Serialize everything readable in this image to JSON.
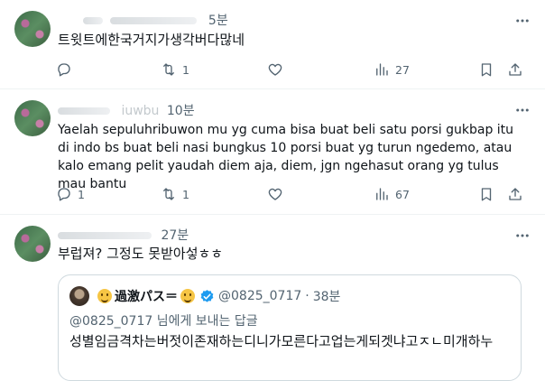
{
  "tweets": [
    {
      "time": "5분",
      "text": "트윗트에한국거지가생각버다많네",
      "stats": {
        "reply": "",
        "retweet": "1",
        "like": "",
        "views": "27"
      }
    },
    {
      "name_fragment": "iuwbu",
      "time": "10분",
      "text": "Yaelah sepuluhribuwon mu yg cuma bisa buat beli satu porsi gukbap itu di indo bs buat beli nasi bungkus 10 porsi buat yg turun ngedemo, atau kalo emang pelit yaudah diem aja, diem, jgn ngehasut orang yg tulus mau bantu",
      "stats": {
        "reply": "1",
        "retweet": "1",
        "like": "",
        "views": "67"
      }
    },
    {
      "time": "27분",
      "text": "부럽져? 그정도 못받아섷ㅎㅎ",
      "quote": {
        "name": "過激パス＝",
        "handle": "@0825_0717",
        "time": "38분",
        "reply_to": "@0825_0717 님에게 보내는 답글",
        "text": "성별임금격차는버젓이존재하는디니가모른다고업는게되겟냐고ㅈㄴ미개하누"
      }
    }
  ],
  "icons": {
    "more": "more-horizontal-icon",
    "reply": "reply-icon",
    "retweet": "retweet-icon",
    "like": "heart-icon",
    "views": "views-icon",
    "bookmark": "bookmark-icon",
    "share": "share-icon",
    "verified": "verified-badge-icon"
  },
  "colors": {
    "text": "#0f1419",
    "muted": "#536471",
    "verified": "#1d9bf0",
    "divider": "#eff3f4"
  }
}
